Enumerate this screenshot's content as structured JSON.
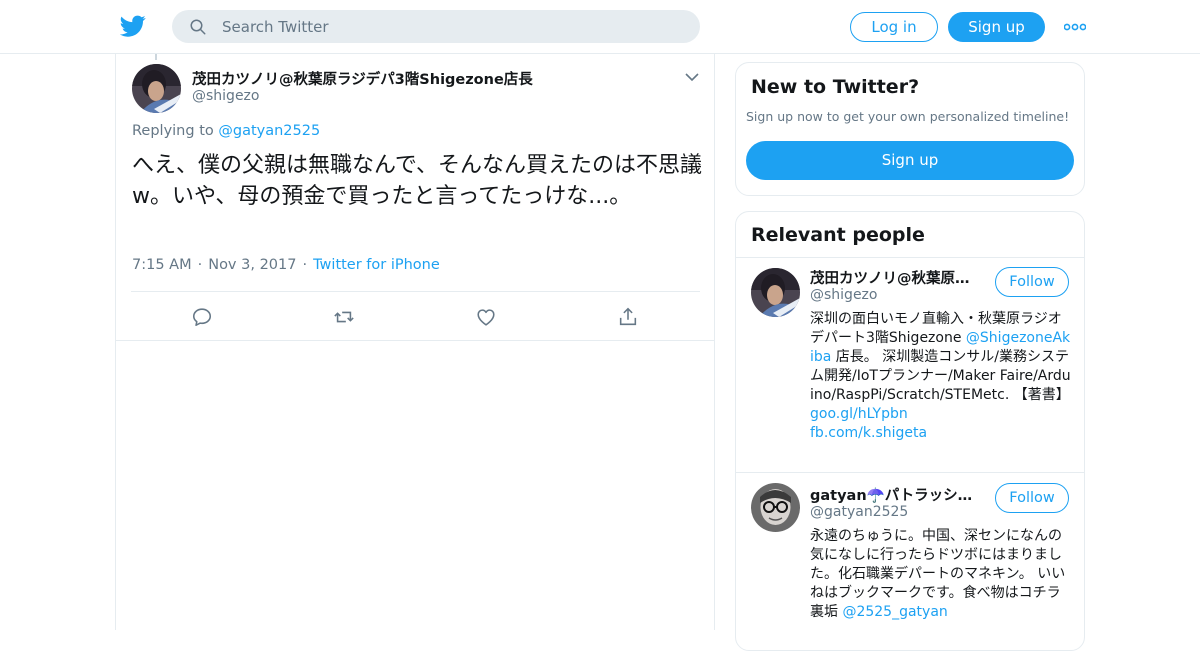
{
  "header": {
    "logo_icon": "twitter-bird-icon",
    "search_placeholder": "Search Twitter",
    "login_label": "Log in",
    "signup_label": "Sign up",
    "more_icon": "more-dots-icon"
  },
  "tweet": {
    "author_name": "茂田カツノリ@秋葉原ラジデパ3階Shigezone店長",
    "author_handle": "@shigezo",
    "replying_prefix": "Replying to",
    "replying_to": "@gatyan2525",
    "text": "へえ、僕の父親は無職なんで、そんなん買えたのは不思議w。いや、母の預金で買ったと言ってたっけな...。",
    "time": "7:15 AM",
    "date": "Nov 3, 2017",
    "client": "Twitter for iPhone",
    "actions": [
      "reply-icon",
      "retweet-icon",
      "like-icon",
      "share-icon"
    ]
  },
  "new_to_twitter": {
    "title": "New to Twitter?",
    "subtitle": "Sign up now to get your own personalized timeline!",
    "button": "Sign up"
  },
  "relevant": {
    "title": "Relevant people",
    "people": [
      {
        "name": "茂田カツノリ@秋葉原…",
        "handle": "@shigezo",
        "follow": "Follow",
        "bio_1": "深圳の面白いモノ直輸入・秋葉原ラジオデパート3階Shigezone ",
        "bio_link_1": "@ShigezoneAkiba",
        "bio_2": " 店長。 深圳製造コンサル/業務システム開発/IoTプランナー/Maker Faire/Arduino/RaspPi/Scratch/STEMetc. 【著書】",
        "bio_link_2": "goo.gl/hLYpbn",
        "bio_link_3": "fb.com/k.shigeta"
      },
      {
        "name": "gatyan☂️パトラッシュ…",
        "handle": "@gatyan2525",
        "follow": "Follow",
        "bio_1": "永遠のちゅうに。中国、深センになんの気になしに行ったらドツボにはまりました。化石職業デパートのマネキン。 いいねはブックマークです。食べ物はコチラ裏垢 ",
        "bio_link_1": "@2525_gatyan"
      }
    ]
  },
  "colors": {
    "accent": "#1da1f2",
    "text": "#14171a",
    "secondary": "#657786",
    "border": "#e6ecf0"
  }
}
